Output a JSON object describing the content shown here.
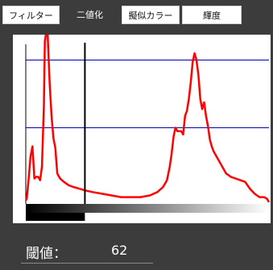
{
  "tabs": [
    {
      "label": "フィルター"
    },
    {
      "label": "二値化",
      "active": true
    },
    {
      "label": "擬似カラー"
    },
    {
      "label": "輝度"
    }
  ],
  "threshold": {
    "label": "閾値：",
    "value": 62
  },
  "chart_data": {
    "type": "line",
    "xlim": [
      0,
      255
    ],
    "ylim": [
      0,
      100
    ],
    "title": "",
    "xlabel": "",
    "ylabel": "",
    "grid": false,
    "reference_lines": [
      {
        "orientation": "horizontal",
        "y": 85,
        "color": "#0000aa"
      },
      {
        "orientation": "horizontal",
        "y": 45,
        "color": "#0000aa"
      }
    ],
    "threshold_marker": {
      "x": 62,
      "color": "#000000"
    },
    "series": [
      {
        "color": "#ff0000",
        "points": [
          [
            0,
            2
          ],
          [
            1,
            3
          ],
          [
            3,
            15
          ],
          [
            5,
            28
          ],
          [
            7,
            34
          ],
          [
            9,
            15
          ],
          [
            11,
            16
          ],
          [
            13,
            16
          ],
          [
            15,
            14
          ],
          [
            17,
            22
          ],
          [
            19,
            58
          ],
          [
            20,
            96
          ],
          [
            21,
            100
          ],
          [
            23,
            100
          ],
          [
            25,
            72
          ],
          [
            27,
            52
          ],
          [
            29,
            39
          ],
          [
            31,
            33
          ],
          [
            33,
            18
          ],
          [
            36,
            15
          ],
          [
            40,
            13
          ],
          [
            45,
            11
          ],
          [
            50,
            10
          ],
          [
            56,
            9
          ],
          [
            62,
            8
          ],
          [
            70,
            7
          ],
          [
            80,
            6
          ],
          [
            90,
            5
          ],
          [
            100,
            4
          ],
          [
            110,
            4
          ],
          [
            120,
            4
          ],
          [
            130,
            5
          ],
          [
            138,
            7
          ],
          [
            144,
            10
          ],
          [
            148,
            14
          ],
          [
            151,
            22
          ],
          [
            153,
            30
          ],
          [
            155,
            40
          ],
          [
            157,
            45
          ],
          [
            159,
            43
          ],
          [
            161,
            43
          ],
          [
            163,
            43
          ],
          [
            165,
            41
          ],
          [
            167,
            52
          ],
          [
            169,
            55
          ],
          [
            171,
            62
          ],
          [
            173,
            72
          ],
          [
            175,
            84
          ],
          [
            177,
            89
          ],
          [
            179,
            85
          ],
          [
            181,
            76
          ],
          [
            183,
            62
          ],
          [
            185,
            56
          ],
          [
            187,
            60
          ],
          [
            189,
            52
          ],
          [
            191,
            46
          ],
          [
            193,
            38
          ],
          [
            195,
            34
          ],
          [
            197,
            31
          ],
          [
            200,
            28
          ],
          [
            205,
            23
          ],
          [
            210,
            18
          ],
          [
            215,
            16
          ],
          [
            220,
            15
          ],
          [
            225,
            14
          ],
          [
            230,
            13
          ],
          [
            235,
            9
          ],
          [
            240,
            6
          ],
          [
            245,
            4
          ],
          [
            250,
            4
          ],
          [
            253,
            3
          ],
          [
            255,
            1
          ]
        ]
      }
    ],
    "gradient_bar": {
      "colors": [
        "#000000",
        "#ffffff"
      ],
      "threshold": 62
    }
  }
}
